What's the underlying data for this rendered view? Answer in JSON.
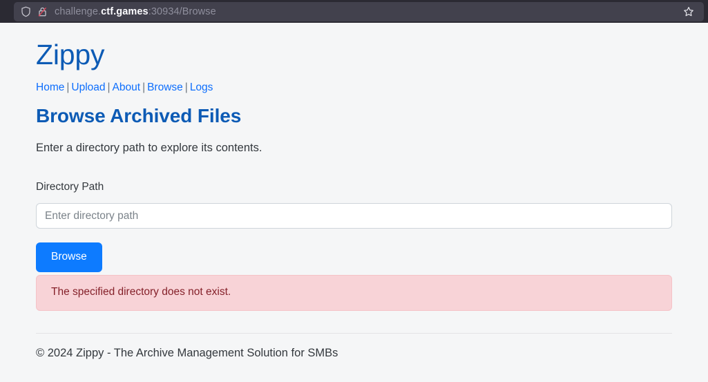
{
  "browser": {
    "shield_icon": "shield-icon",
    "lock_icon": "lock-crossed-icon",
    "star_icon": "bookmark-star-icon",
    "url": {
      "prefix": "challenge.",
      "host": "ctf.games",
      "suffix": ":30934/Browse"
    }
  },
  "page": {
    "brand": "Zippy",
    "title": "Browse Archived Files",
    "lead": "Enter a directory path to explore its contents.",
    "nav": {
      "separator": "|",
      "items": [
        {
          "label": "Home"
        },
        {
          "label": "Upload"
        },
        {
          "label": "About"
        },
        {
          "label": "Browse"
        },
        {
          "label": "Logs"
        }
      ]
    },
    "form": {
      "label": "Directory Path",
      "input_value": "",
      "input_placeholder": "Enter directory path",
      "submit_label": "Browse"
    },
    "alert": {
      "type": "danger",
      "message": "The specified directory does not exist.",
      "bg_color": "#f8d3d7",
      "text_color": "#842029"
    },
    "footer": "© 2024 Zippy - The Archive Management Solution for SMBs",
    "colors": {
      "heading": "#0d5bb5",
      "link": "#0d6efd",
      "button": "#0d7bff",
      "page_bg": "#f5f6f7"
    }
  }
}
